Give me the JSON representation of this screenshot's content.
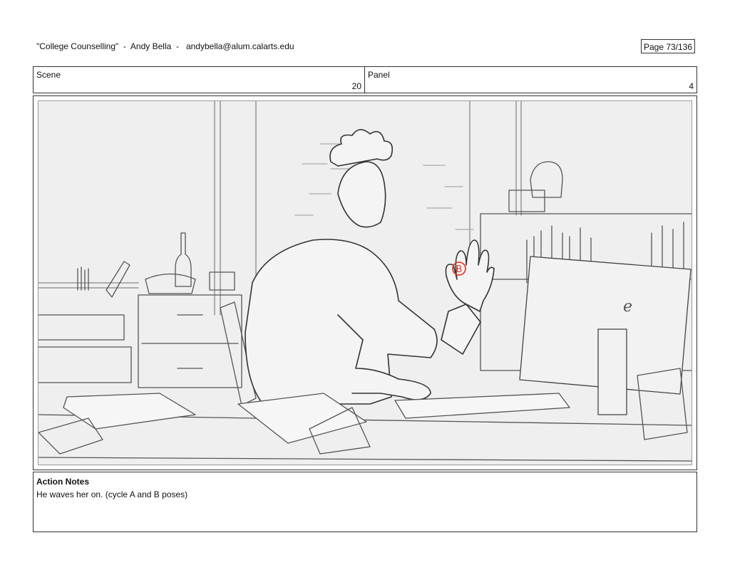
{
  "header": {
    "title": "\"College Counselling\"  -  Andy Bella  -   andybella@alum.calarts.edu",
    "page": "Page  73/136"
  },
  "scene": {
    "label": "Scene",
    "value": "20"
  },
  "panel": {
    "label": "Panel",
    "value": "4"
  },
  "sketch": {
    "annotation": "B",
    "annotation_color": "#e0402a",
    "monitor_logo": "e"
  },
  "notes": {
    "title": "Action Notes",
    "text": "He waves her on. (cycle A and B poses)"
  }
}
